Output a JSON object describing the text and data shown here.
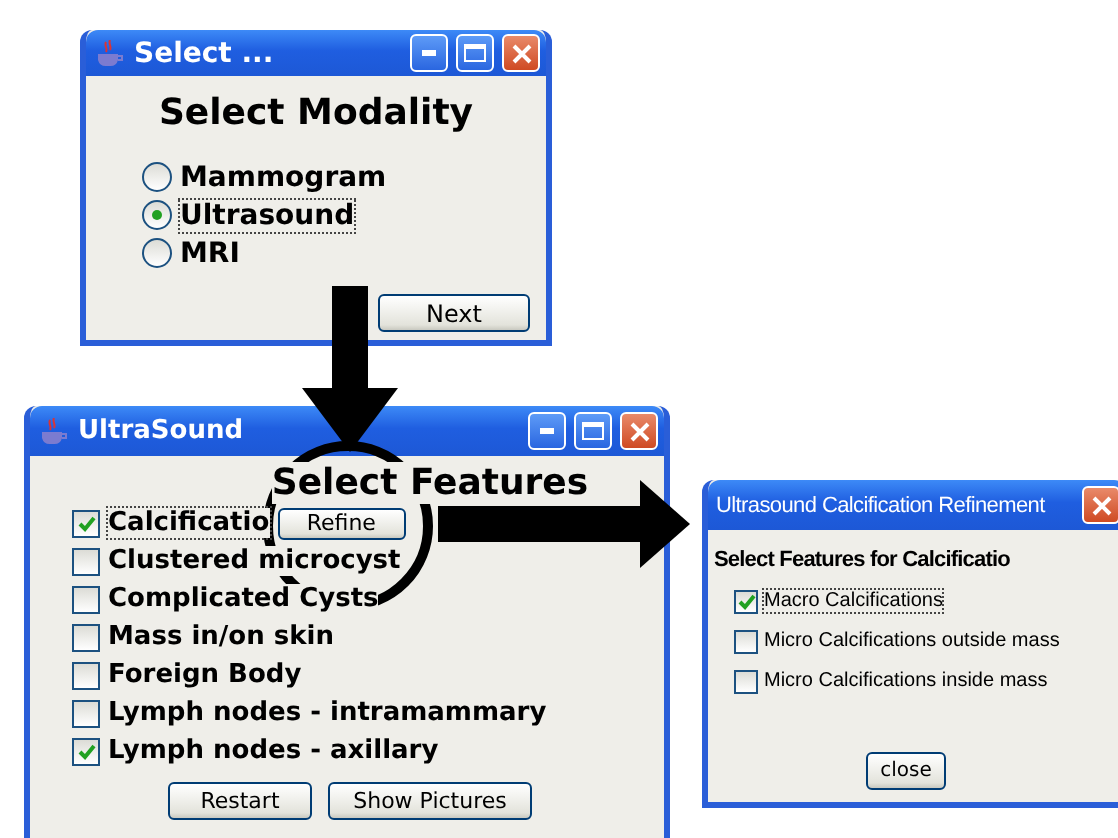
{
  "modality_window": {
    "title": "Select ...",
    "heading": "Select Modality",
    "options": [
      {
        "label": "Mammogram",
        "selected": false
      },
      {
        "label": "Ultrasound",
        "selected": true
      },
      {
        "label": "MRI",
        "selected": false
      }
    ],
    "button": "Next"
  },
  "features_window": {
    "title": "UltraSound",
    "heading": "Select Features",
    "items": [
      {
        "label": "Calcificatio",
        "checked": true,
        "action": "Refine"
      },
      {
        "label": "Clustered microcyst",
        "checked": false
      },
      {
        "label": "Complicated Cysts",
        "checked": false
      },
      {
        "label": "Mass in/on skin",
        "checked": false
      },
      {
        "label": "Foreign Body",
        "checked": false
      },
      {
        "label": "Lymph nodes - intramammary",
        "checked": false
      },
      {
        "label": "Lymph nodes - axillary",
        "checked": true
      }
    ],
    "buttons": [
      "Restart",
      "Show Pictures"
    ]
  },
  "refinement_window": {
    "title": "Ultrasound Calcification Refinement",
    "heading": "Select Features for Calcificatio",
    "items": [
      {
        "label": "Macro Calcifications",
        "checked": true
      },
      {
        "label": "Micro Calcifications outside mass",
        "checked": false
      },
      {
        "label": "Micro Calcifications inside mass",
        "checked": false
      }
    ],
    "button": "close"
  }
}
